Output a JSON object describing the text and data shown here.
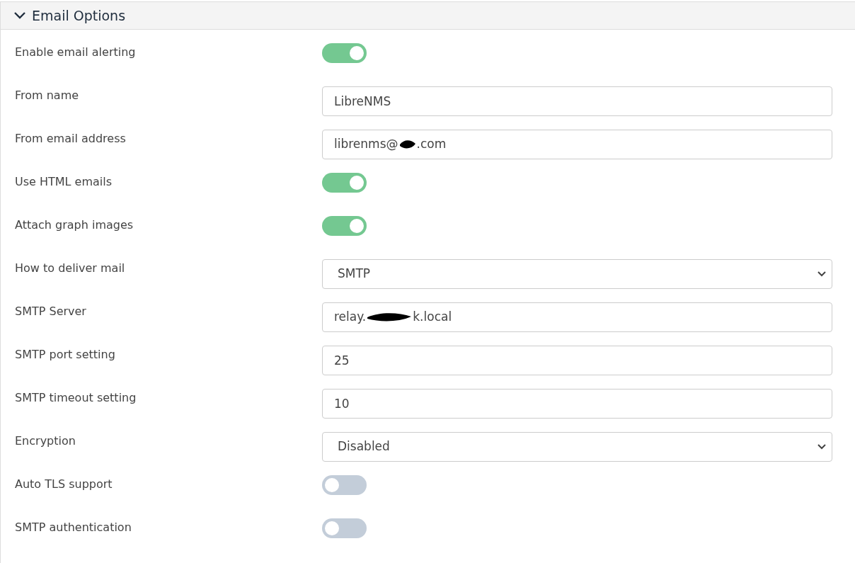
{
  "panel": {
    "title": "Email Options",
    "expanded": true
  },
  "settings": [
    {
      "label": "Enable email alerting",
      "kind": "toggle",
      "on": true
    },
    {
      "label": "From name",
      "kind": "text",
      "value": "LibreNMS"
    },
    {
      "label": "From email address",
      "kind": "redacted",
      "value_start": "librenms@",
      "value_end": ".com"
    },
    {
      "label": "Use HTML emails",
      "kind": "toggle",
      "on": true
    },
    {
      "label": "Attach graph images",
      "kind": "toggle",
      "on": true
    },
    {
      "label": "How to deliver mail",
      "kind": "select",
      "value": "SMTP"
    },
    {
      "label": "SMTP Server",
      "kind": "redacted",
      "value_start": "relay.",
      "value_end": "k.local"
    },
    {
      "label": "SMTP port setting",
      "kind": "text",
      "value": "25"
    },
    {
      "label": "SMTP timeout setting",
      "kind": "text",
      "value": "10"
    },
    {
      "label": "Encryption",
      "kind": "select",
      "value": "Disabled"
    },
    {
      "label": "Auto TLS support",
      "kind": "toggle",
      "on": false
    },
    {
      "label": "SMTP authentication",
      "kind": "toggle",
      "on": false
    }
  ]
}
